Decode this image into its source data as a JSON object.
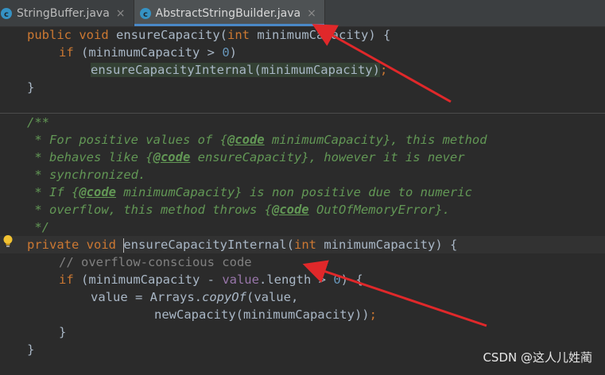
{
  "tabs": [
    {
      "label": "StringBuffer.java",
      "active": false
    },
    {
      "label": "AbstractStringBuilder.java",
      "active": true
    }
  ],
  "tab_close_glyph": "×",
  "code": {
    "ensure_capacity": {
      "kw_public": "public",
      "kw_void": "void",
      "method": "ensureCapacity",
      "open_paren": "(",
      "kw_int": "int",
      "param": "minimumCapacity",
      "close_open": ") {",
      "kw_if": "if",
      "cond_open": " (minimumCapacity > ",
      "zero": "0",
      "cond_close": ")",
      "call": "ensureCapacityInternal",
      "call_args": "(minimumCapacity)",
      "semicolon": ";",
      "close_brace": "}"
    },
    "javadoc": {
      "open": "/**",
      "l1_a": " * For positive values of {",
      "l1_tag": "@code",
      "l1_b": " minimumCapacity}, this method",
      "l2_a": " * behaves like {",
      "l2_tag": "@code",
      "l2_b": " ensureCapacity}, however it is never",
      "l3": " * synchronized.",
      "l4_a": " * If {",
      "l4_tag": "@code",
      "l4_b": " minimumCapacity} is non positive due to numeric",
      "l5_a": " * overflow, this method throws {",
      "l5_tag": "@code",
      "l5_b": " OutOfMemoryError}.",
      "close": " */"
    },
    "internal": {
      "kw_private": "private",
      "kw_void": "void",
      "method": "ensureCapacityInternal",
      "open_paren": "(",
      "kw_int": "int",
      "param": "minimumCapacity",
      "close_open": ") {",
      "comment": "// overflow-conscious code",
      "kw_if": "if",
      "cond_a": " (minimumCapacity - ",
      "field": "value",
      "cond_b": ".length > ",
      "zero": "0",
      "cond_c": ") {",
      "assign_a": "value = Arrays.",
      "static_call": "copyOf",
      "assign_b": "(value,",
      "arg2": "newCapacity(minimumCapacity))",
      "semicolon": ";",
      "inner_close": "}",
      "close_brace": "}"
    }
  },
  "watermark": "CSDN @这人儿姓蔺",
  "icons": {
    "tab_icon": "java-class-icon",
    "gutter_icon": "lightbulb-icon",
    "annotation": "red-arrow-icon"
  },
  "colors": {
    "background": "#2b2b2b",
    "keyword": "#cc7832",
    "number": "#6897bb",
    "doc_comment": "#629755",
    "line_comment": "#808080",
    "default_text": "#a9b7c6",
    "field": "#9876aa",
    "arrow": "#e0282a",
    "tab_accent": "#4a88c7"
  }
}
